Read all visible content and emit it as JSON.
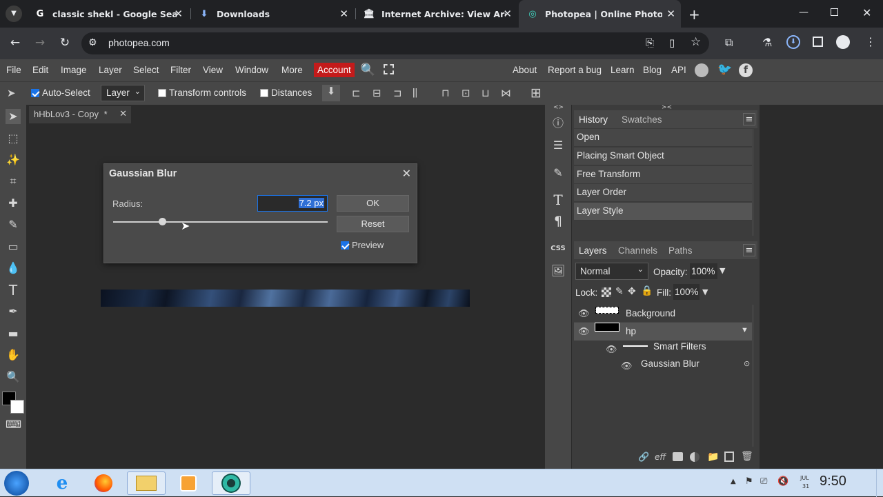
{
  "browser": {
    "tabs": [
      {
        "title": "classic shekl - Google Search",
        "icon": "google-icon"
      },
      {
        "title": "Downloads",
        "icon": "download-icon"
      },
      {
        "title": "Internet Archive: View Archive",
        "icon": "archive-icon"
      },
      {
        "title": "Photopea | Online Photo Edito",
        "icon": "photopea-icon"
      }
    ],
    "url": "photopea.com"
  },
  "menubar": {
    "items": [
      "File",
      "Edit",
      "Image",
      "Layer",
      "Select",
      "Filter",
      "View",
      "Window",
      "More"
    ],
    "account": "Account",
    "right_items": [
      "About",
      "Report a bug",
      "Learn",
      "Blog",
      "API"
    ]
  },
  "options": {
    "auto_select": "Auto-Select",
    "layer_select": "Layer",
    "transform_controls": "Transform controls",
    "distances": "Distances"
  },
  "document": {
    "tab_title": "hHbLov3 - Copy",
    "modified_mark": "*"
  },
  "dialog": {
    "title": "Gaussian Blur",
    "radius_label": "Radius:",
    "radius_value": "7.2 px",
    "slider_fraction": 0.23,
    "ok_label": "OK",
    "reset_label": "Reset",
    "preview_label": "Preview"
  },
  "history_panel": {
    "tabs": [
      "History",
      "Swatches"
    ],
    "items": [
      "Open",
      "Placing Smart Object",
      "Free Transform",
      "Layer Order",
      "Layer Style"
    ]
  },
  "layers_panel": {
    "tabs": [
      "Layers",
      "Channels",
      "Paths"
    ],
    "blend_mode": "Normal",
    "opacity_label": "Opacity:",
    "opacity_value": "100%",
    "lock_label": "Lock:",
    "fill_label": "Fill:",
    "fill_value": "100%",
    "layers": [
      {
        "name": "Background"
      },
      {
        "name": "hp"
      },
      {
        "name": "Smart Filters"
      },
      {
        "name": "Gaussian Blur"
      }
    ]
  },
  "taskbar": {
    "clock_time": "9:50",
    "clock_date_top": "JUL",
    "clock_date_bottom": "31"
  }
}
